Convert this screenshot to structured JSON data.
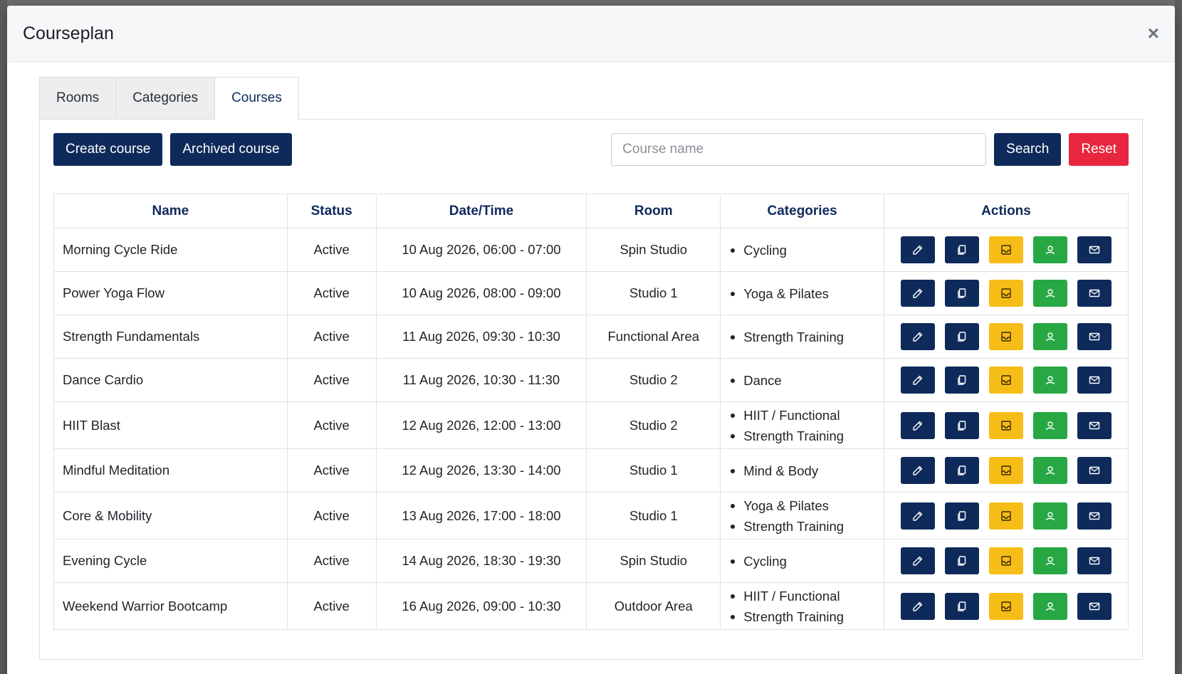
{
  "modal": {
    "title": "Courseplan",
    "close_symbol": "×"
  },
  "tabs": [
    {
      "label": "Rooms",
      "active": false
    },
    {
      "label": "Categories",
      "active": false
    },
    {
      "label": "Courses",
      "active": true
    }
  ],
  "toolbar": {
    "create_label": "Create course",
    "archived_label": "Archived course",
    "search_placeholder": "Course name",
    "search_value": "",
    "search_label": "Search",
    "reset_label": "Reset"
  },
  "table": {
    "headers": [
      "Name",
      "Status",
      "Date/Time",
      "Room",
      "Categories",
      "Actions"
    ],
    "rows": [
      {
        "name": "Morning Cycle Ride",
        "status": "Active",
        "datetime": "10 Aug 2026, 06:00 - 07:00",
        "room": "Spin Studio",
        "categories": [
          "Cycling"
        ]
      },
      {
        "name": "Power Yoga Flow",
        "status": "Active",
        "datetime": "10 Aug 2026, 08:00 - 09:00",
        "room": "Studio 1",
        "categories": [
          "Yoga & Pilates"
        ]
      },
      {
        "name": "Strength Fundamentals",
        "status": "Active",
        "datetime": "11 Aug 2026, 09:30 - 10:30",
        "room": "Functional Area",
        "categories": [
          "Strength Training"
        ]
      },
      {
        "name": "Dance Cardio",
        "status": "Active",
        "datetime": "11 Aug 2026, 10:30 - 11:30",
        "room": "Studio 2",
        "categories": [
          "Dance"
        ]
      },
      {
        "name": "HIIT Blast",
        "status": "Active",
        "datetime": "12 Aug 2026, 12:00 - 13:00",
        "room": "Studio 2",
        "categories": [
          "HIIT / Functional",
          "Strength Training"
        ]
      },
      {
        "name": "Mindful Meditation",
        "status": "Active",
        "datetime": "12 Aug 2026, 13:30 - 14:00",
        "room": "Studio 1",
        "categories": [
          "Mind & Body"
        ]
      },
      {
        "name": "Core & Mobility",
        "status": "Active",
        "datetime": "13 Aug 2026, 17:00 - 18:00",
        "room": "Studio 1",
        "categories": [
          "Yoga & Pilates",
          "Strength Training"
        ]
      },
      {
        "name": "Evening Cycle",
        "status": "Active",
        "datetime": "14 Aug 2026, 18:30 - 19:30",
        "room": "Spin Studio",
        "categories": [
          "Cycling"
        ]
      },
      {
        "name": "Weekend Warrior Bootcamp",
        "status": "Active",
        "datetime": "16 Aug 2026, 09:00 - 10:30",
        "room": "Outdoor Area",
        "categories": [
          "HIIT / Functional",
          "Strength Training"
        ]
      }
    ],
    "actions": [
      {
        "icon": "pencil-icon",
        "name": "edit-button",
        "color": "#0e2a5a"
      },
      {
        "icon": "copy-icon",
        "name": "duplicate-button",
        "color": "#0e2a5a"
      },
      {
        "icon": "archive-icon",
        "name": "archive-button",
        "color": "#f6bd16"
      },
      {
        "icon": "users-icon",
        "name": "participants-button",
        "color": "#27a844"
      },
      {
        "icon": "envelope-icon",
        "name": "email-button",
        "color": "#0e2a5a"
      }
    ]
  },
  "colors": {
    "primary_navy": "#0e2a5a",
    "danger_red": "#e8263f",
    "warning_yellow": "#f6bd16",
    "success_green": "#27a844"
  }
}
